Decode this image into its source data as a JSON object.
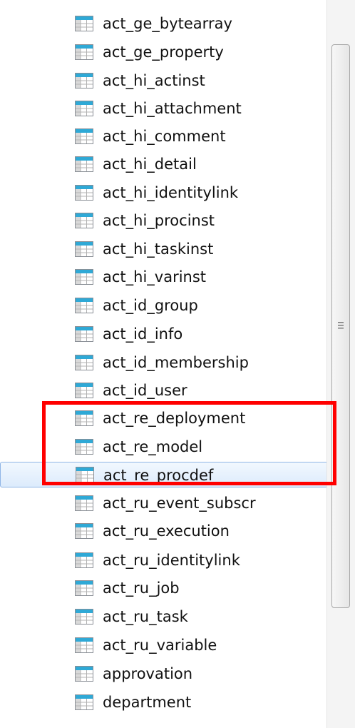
{
  "tree": {
    "items": [
      {
        "label": "act_ge_bytearray",
        "icon": "table-icon"
      },
      {
        "label": "act_ge_property",
        "icon": "table-icon"
      },
      {
        "label": "act_hi_actinst",
        "icon": "table-icon"
      },
      {
        "label": "act_hi_attachment",
        "icon": "table-icon"
      },
      {
        "label": "act_hi_comment",
        "icon": "table-icon"
      },
      {
        "label": "act_hi_detail",
        "icon": "table-icon"
      },
      {
        "label": "act_hi_identitylink",
        "icon": "table-icon"
      },
      {
        "label": "act_hi_procinst",
        "icon": "table-icon"
      },
      {
        "label": "act_hi_taskinst",
        "icon": "table-icon"
      },
      {
        "label": "act_hi_varinst",
        "icon": "table-icon"
      },
      {
        "label": "act_id_group",
        "icon": "table-icon"
      },
      {
        "label": "act_id_info",
        "icon": "table-icon"
      },
      {
        "label": "act_id_membership",
        "icon": "table-icon"
      },
      {
        "label": "act_id_user",
        "icon": "table-icon"
      },
      {
        "label": "act_re_deployment",
        "icon": "table-icon"
      },
      {
        "label": "act_re_model",
        "icon": "table-icon"
      },
      {
        "label": "act_re_procdef",
        "icon": "table-icon",
        "selected": true
      },
      {
        "label": "act_ru_event_subscr",
        "icon": "table-icon"
      },
      {
        "label": "act_ru_execution",
        "icon": "table-icon"
      },
      {
        "label": "act_ru_identitylink",
        "icon": "table-icon"
      },
      {
        "label": "act_ru_job",
        "icon": "table-icon"
      },
      {
        "label": "act_ru_task",
        "icon": "table-icon"
      },
      {
        "label": "act_ru_variable",
        "icon": "table-icon"
      },
      {
        "label": "approvation",
        "icon": "table-icon"
      },
      {
        "label": "department",
        "icon": "table-icon"
      }
    ]
  },
  "highlight": {
    "color": "#ff0000"
  },
  "colors": {
    "selection_fill": "#dcebfc",
    "selection_border": "#8fb5e6",
    "icon_header": "#2fa9d6"
  }
}
